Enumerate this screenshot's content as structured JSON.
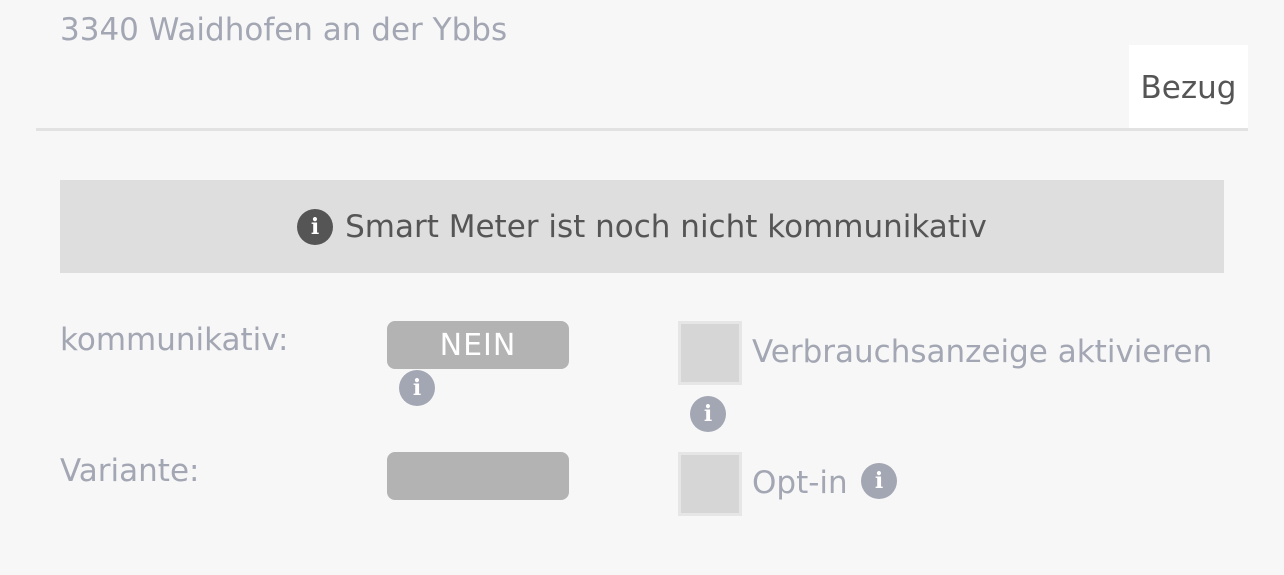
{
  "header": {
    "address": "3340 Waidhofen an der Ybbs",
    "tab_label": "Bezug"
  },
  "notice": {
    "icon": "info-icon",
    "text": "Smart Meter ist noch nicht kommunikativ"
  },
  "fields": {
    "kommunikativ": {
      "label": "kommunikativ:",
      "value": "NEIN",
      "info_icon": "info-icon"
    },
    "variante": {
      "label": "Variante:",
      "value": ""
    }
  },
  "options": {
    "verbrauchsanzeige": {
      "label": "Verbrauchsanzeige aktivieren",
      "checked": false,
      "info_icon": "info-icon"
    },
    "optin": {
      "label": "Opt-in",
      "checked": false,
      "info_icon": "info-icon"
    }
  },
  "colors": {
    "background": "#f7f7f7",
    "muted_text": "#a3a6b3",
    "dark_text": "#555555",
    "notice_bg": "#dedede",
    "pill_bg": "#b3b3b3"
  }
}
